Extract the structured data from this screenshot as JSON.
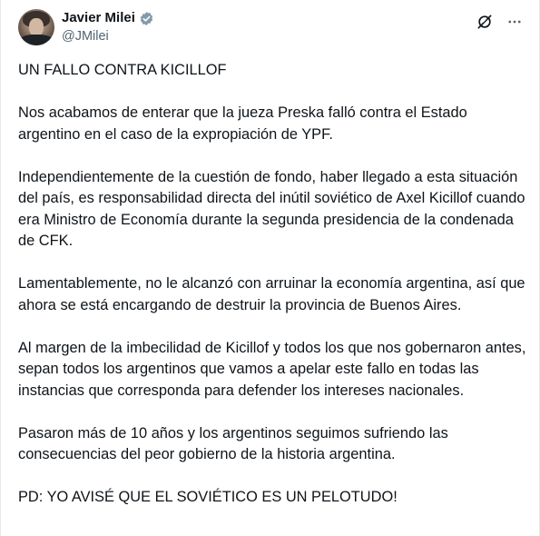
{
  "author": {
    "name": "Javier Milei",
    "handle": "@JMilei",
    "verified_color": "#829aab"
  },
  "icons": {
    "verified": "verified-badge-icon",
    "grok": "grok-icon",
    "more": "more-options-icon"
  },
  "tweet": {
    "paragraphs": [
      "UN FALLO CONTRA KICILLOF",
      "Nos acabamos de enterar que la jueza Preska falló contra el Estado argentino en el caso de la expropiación de YPF.",
      "Independientemente de la cuestión de fondo, haber llegado a esta situación del país, es responsabilidad directa del inútil soviético de Axel Kicillof cuando era Ministro de Economía durante la segunda presidencia de la condenada de CFK.",
      "Lamentablemente, no le alcanzó con arruinar la economía argentina, así que ahora se está encargando de destruir la provincia de Buenos Aires.",
      "Al margen de la imbecilidad de Kicillof y todos los que nos gobernaron antes, sepan todos los argentinos que vamos a apelar este fallo en todas las instancias que corresponda para defender los intereses nacionales.",
      "Pasaron más de 10 años y los argentinos seguimos sufriendo las consecuencias del peor gobierno de la historia argentina.",
      "PD: YO AVISÉ QUE EL SOVIÉTICO ES UN PELOTUDO!"
    ]
  },
  "colors": {
    "text": "#0f1419",
    "secondary": "#536471"
  }
}
